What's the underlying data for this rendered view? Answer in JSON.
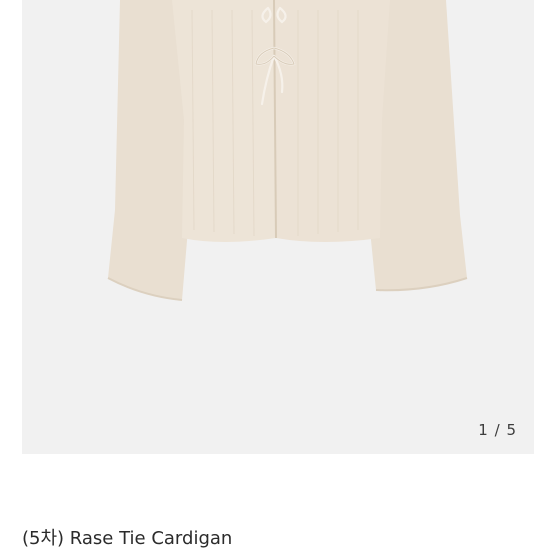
{
  "gallery": {
    "current": "1",
    "separator": "/",
    "total": "5",
    "background": "#f1f1f1",
    "garment_color": "#ece3d6"
  },
  "product": {
    "title": "(5차) Rase Tie Cardigan"
  }
}
